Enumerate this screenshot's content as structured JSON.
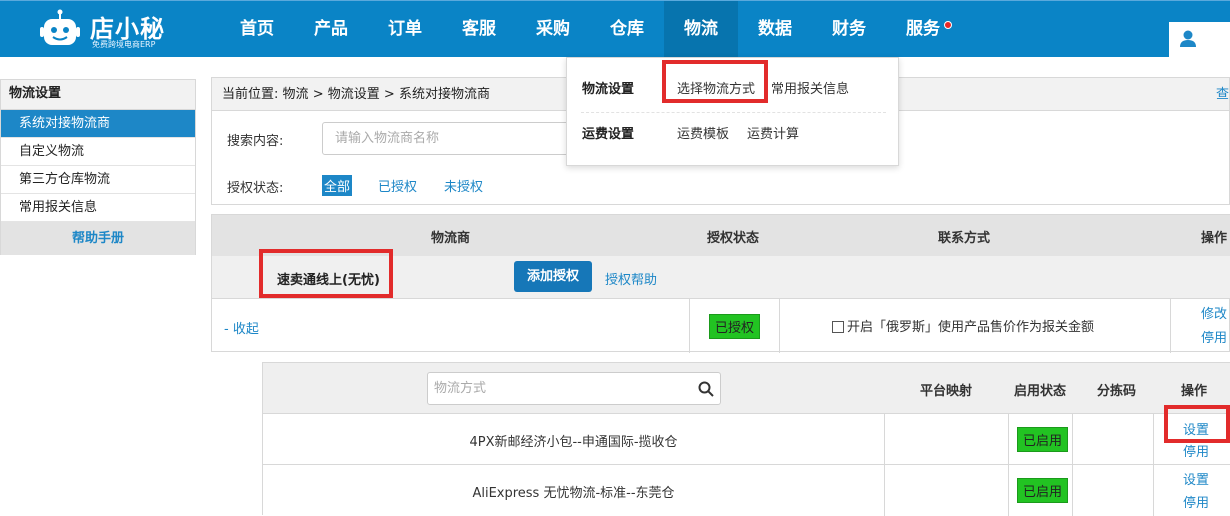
{
  "brand": {
    "name": "店小秘",
    "tagline": "免费跨境电商ERP"
  },
  "nav": {
    "items": [
      {
        "label": "首页"
      },
      {
        "label": "产品"
      },
      {
        "label": "订单"
      },
      {
        "label": "客服"
      },
      {
        "label": "采购"
      },
      {
        "label": "仓库"
      },
      {
        "label": "物流",
        "active": true
      },
      {
        "label": "数据"
      },
      {
        "label": "财务"
      },
      {
        "label": "服务",
        "notification": true
      }
    ],
    "user_icon": "user-icon"
  },
  "dropdown": {
    "groups": [
      {
        "title": "物流设置",
        "links": [
          "选择物流方式",
          "常用报关信息"
        ]
      },
      {
        "title": "运费设置",
        "links": [
          "运费模板",
          "运费计算"
        ]
      }
    ]
  },
  "sidebar": {
    "title": "物流设置",
    "items": [
      "系统对接物流商",
      "自定义物流",
      "第三方仓库物流",
      "常用报关信息"
    ],
    "active_index": 0,
    "help": "帮助手册"
  },
  "breadcrumb": {
    "prefix": "当前位置:",
    "path": [
      "物流",
      "物流设置",
      "系统对接物流商"
    ],
    "right_link": "查"
  },
  "filters": {
    "search_label": "搜索内容:",
    "search_placeholder": "请输入物流商名称",
    "auth_label": "授权状态:",
    "auth_options": [
      "全部",
      "已授权",
      "未授权"
    ]
  },
  "table": {
    "headers": [
      "物流商",
      "授权状态",
      "联系方式",
      "操作"
    ],
    "carrier": {
      "name": "速卖通线上(无忧)",
      "add_auth": "添加授权",
      "auth_help": "授权帮助",
      "collapse": "- 收起",
      "status": "已授权",
      "checkbox_label": "开启「俄罗斯」使用产品售价作为报关金额",
      "ops": [
        "修改",
        "停用"
      ]
    }
  },
  "methods": {
    "search_placeholder": "物流方式",
    "headers": [
      "平台映射",
      "启用状态",
      "分拣码",
      "操作"
    ],
    "rows": [
      {
        "name": "4PX新邮经济小包--申通国际-揽收仓",
        "status": "已启用",
        "ops": [
          "设置",
          "停用"
        ]
      },
      {
        "name": "AliExpress 无忧物流-标准--东莞仓",
        "status": "已启用",
        "ops": [
          "设置",
          "停用"
        ]
      }
    ]
  },
  "colors": {
    "topbar": "#0a84c6",
    "accent": "#1d87c7",
    "enabled_badge": "#22c322",
    "highlight": "#e22b2b"
  }
}
